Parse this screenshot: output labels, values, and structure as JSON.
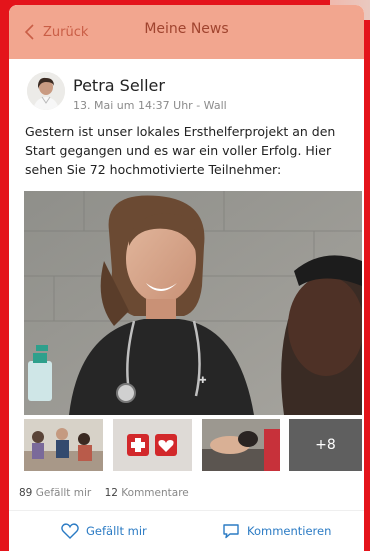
{
  "header": {
    "back_label": "Zurück",
    "title": "Meine News"
  },
  "post": {
    "author": "Petra Seller",
    "meta": "13. Mai um 14:37 Uhr - Wall",
    "text": "Gestern ist unser lokales Ersthelferprojekt an den Start gegangen und es war ein voller Erfolg. Hier sehen Sie 72 hochmotivierte Teilnehmer:",
    "more_photos_label": "+8"
  },
  "stats": {
    "likes_count": "89",
    "likes_label": "Gefällt mir",
    "comments_count": "12",
    "comments_label": "Kommentare"
  },
  "actions": {
    "like_label": "Gefällt mir",
    "comment_label": "Kommentieren"
  },
  "colors": {
    "brand_red": "#e4141b",
    "header_bg": "#f2a68f",
    "action_blue": "#2b7bc4"
  }
}
